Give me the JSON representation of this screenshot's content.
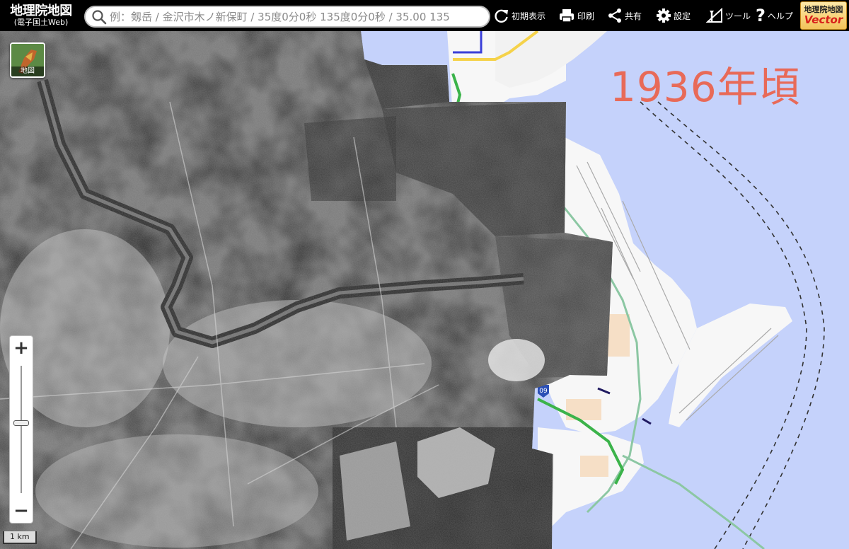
{
  "header": {
    "logo": {
      "title": "地理院地図",
      "subtitle": "(電子国土Web)"
    },
    "search": {
      "placeholder": "例：剱岳 / 金沢市木ノ新保町 / 35度0分0秒 135度0分0秒 / 35.00 135"
    },
    "buttons": {
      "reset": "初期表示",
      "print": "印刷",
      "share": "共有",
      "settings": "設定",
      "tools": "ツール",
      "help": "ヘルプ"
    },
    "vector_badge": {
      "top": "地理院地図",
      "bottom": "Vector"
    }
  },
  "map": {
    "year_label": "1936年頃",
    "layer_button_label": "地図",
    "route_badge": "09",
    "scale_label": "1 km",
    "zoom": {
      "in": "+",
      "out": "−",
      "level": 0.45
    },
    "colors": {
      "water": "#c5d2fb",
      "land": "#f7f7f7",
      "road": "#8cc7a3",
      "highway": "#3bb34a",
      "year_label": "#e86a58"
    }
  }
}
